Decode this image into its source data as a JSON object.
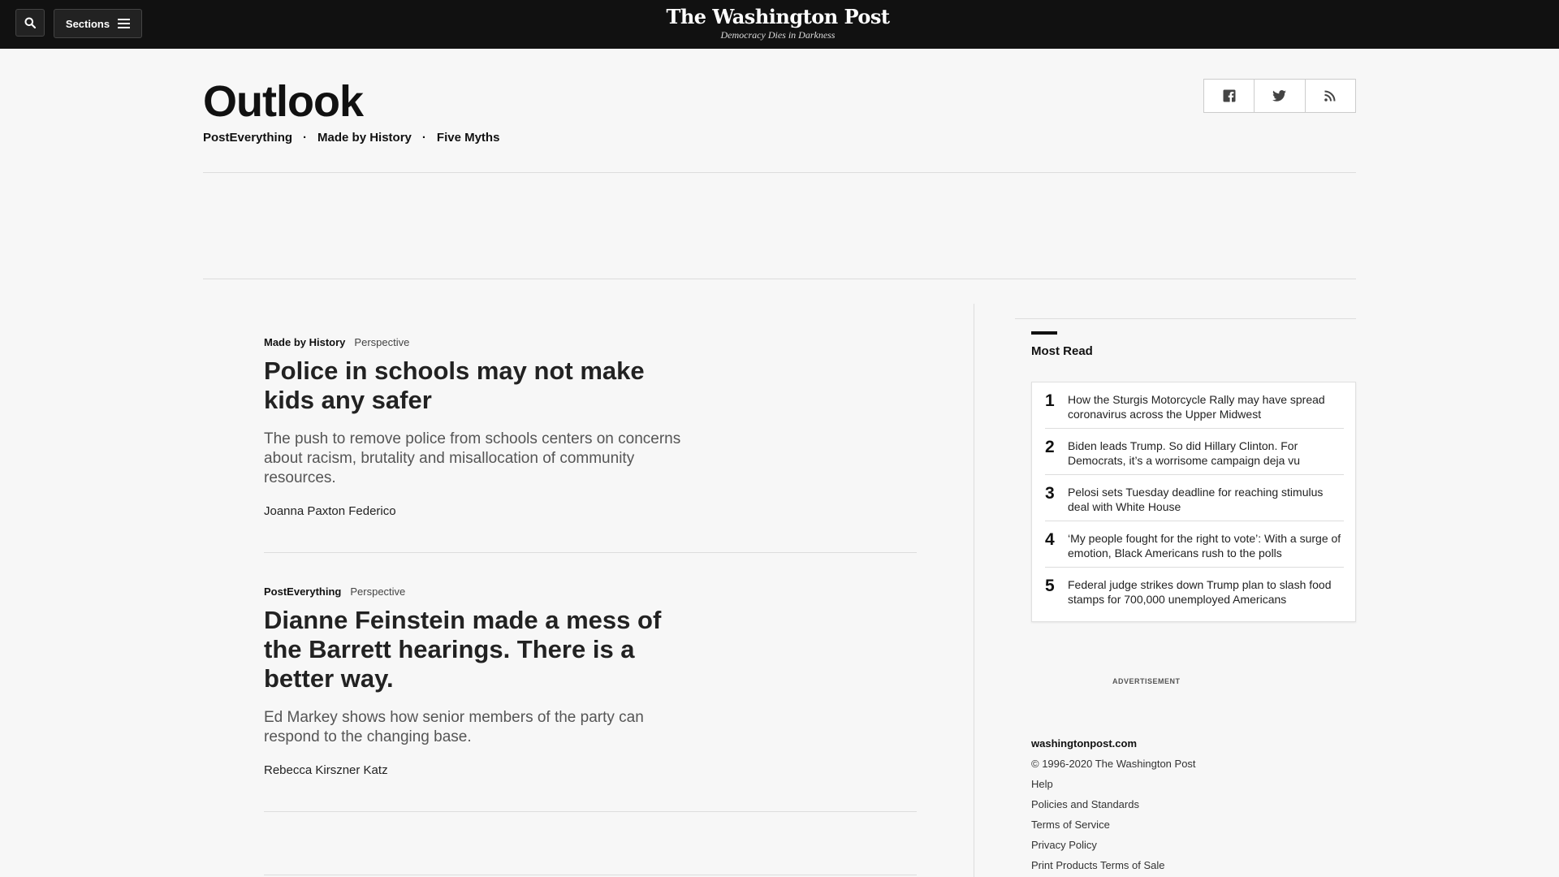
{
  "header": {
    "sections_label": "Sections",
    "logo": "The Washington Post",
    "tagline": "Democracy Dies in Darkness"
  },
  "section": {
    "title": "Outlook",
    "subnav": [
      "PostEverything",
      "Made by History",
      "Five Myths"
    ]
  },
  "share_icons": [
    "facebook-icon",
    "twitter-icon",
    "rss-icon"
  ],
  "articles": [
    {
      "kicker_label": "Made by History",
      "kicker_type": "Perspective",
      "headline": "Police in schools may not make kids any safer",
      "blurb": "The push to remove police from schools centers on concerns about racism, brutality and misallocation of community resources.",
      "byline": "Joanna Paxton Federico"
    },
    {
      "kicker_label": "PostEverything",
      "kicker_type": "Perspective",
      "headline": "Dianne Feinstein made a mess of the Barrett hearings. There is a better way.",
      "blurb": "Ed Markey shows how senior members of the party can respond to the changing base.",
      "byline": "Rebecca Kirszner Katz"
    }
  ],
  "most_read": {
    "title": "Most Read",
    "items": [
      {
        "num": "1",
        "title": "How the Sturgis Motorcycle Rally may have spread coronavirus across the Upper Midwest"
      },
      {
        "num": "2",
        "title": "Biden leads Trump. So did Hillary Clinton. For Democrats, it’s a worrisome campaign deja vu"
      },
      {
        "num": "3",
        "title": "Pelosi sets Tuesday deadline for reaching stimulus deal with White House"
      },
      {
        "num": "4",
        "title": "‘My people fought for the right to vote’: With a surge of emotion, Black Americans rush to the polls"
      },
      {
        "num": "5",
        "title": "Federal judge strikes down Trump plan to slash food stamps for 700,000 unemployed Americans"
      }
    ]
  },
  "ad_label": "ADVERTISEMENT",
  "footer": {
    "site": "washingtonpost.com",
    "copyright": "© 1996-2020 The Washington Post",
    "links": [
      "Help",
      "Policies and Standards",
      "Terms of Service",
      "Privacy Policy",
      "Print Products Terms of Sale"
    ]
  }
}
